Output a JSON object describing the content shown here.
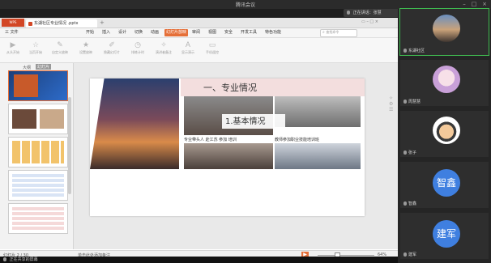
{
  "window": {
    "title": "腾讯会议"
  },
  "meeting": {
    "speaker_label": "正在讲话：张慧",
    "bottom_label": "正在共享的屏幕"
  },
  "wps": {
    "doc_tab": "东湖社区专业情况 .pptx",
    "menu": [
      "三 文件",
      "开始",
      "插入",
      "设计",
      "切换",
      "动画",
      "幻灯片放映",
      "审阅",
      "视图",
      "安全",
      "开发工具",
      "特色功能"
    ],
    "active_menu_index": 6,
    "search_placeholder": "查找命令",
    "ribbon": [
      "从头开始",
      "当页开始",
      "自定义放映",
      "设置放映",
      "隐藏幻灯片",
      "排练计时",
      "演讲者备注",
      "显示演示",
      "手机遥控"
    ],
    "pane_tabs": [
      "大纲",
      "幻灯片"
    ],
    "status_left": "幻灯片 2 / 30",
    "notes_placeholder": "单击此处添加备注",
    "zoom": "64%"
  },
  "slide": {
    "heading": "一、专业情况",
    "subheading": "1.基本情况",
    "photo_caption_left": "专业带头人 赴江苏 参加 培训",
    "photo_caption_right": "教师参加职业技能培训班"
  },
  "participants": [
    {
      "name": "东湖社区",
      "type": "photo-city"
    },
    {
      "name": "周慧慧",
      "type": "photo-girl"
    },
    {
      "name": "张子",
      "type": "cartoon"
    },
    {
      "name": "智鑫",
      "avatar": "智鑫",
      "type": "text"
    },
    {
      "name": "建军",
      "avatar": "建军",
      "type": "text"
    }
  ],
  "colors": {
    "accent": "#e56f38",
    "avatar_blue": "#3f7fe0",
    "active_border": "#3fb950"
  }
}
